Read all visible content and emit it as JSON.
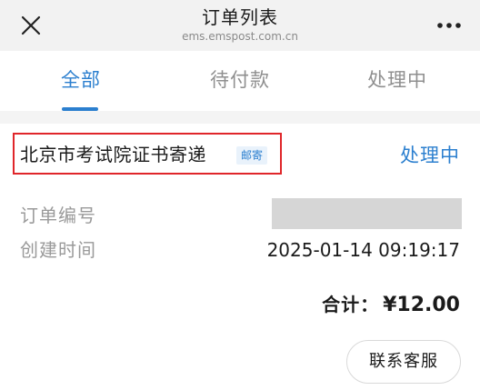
{
  "header": {
    "title": "订单列表",
    "domain": "ems.emspost.com.cn",
    "close_icon": "close-icon",
    "more_icon": "more-dots-icon"
  },
  "tabs": [
    {
      "label": "全部",
      "active": true
    },
    {
      "label": "待付款",
      "active": false
    },
    {
      "label": "处理中",
      "active": false
    }
  ],
  "order": {
    "name": "北京市考试院证书寄递",
    "badge": "邮寄",
    "status": "处理中",
    "order_number_label": "订单编号",
    "created_time_label": "创建时间",
    "created_time": "2025-01-14 09:19:17",
    "total_label": "合计：",
    "total_amount": "¥12.00",
    "service_button": "联系客服"
  },
  "colors": {
    "accent": "#2b7fcf",
    "highlight_border": "#e0262a",
    "header_bg": "#f2f2f2",
    "redaction": "#d6d6d6"
  }
}
